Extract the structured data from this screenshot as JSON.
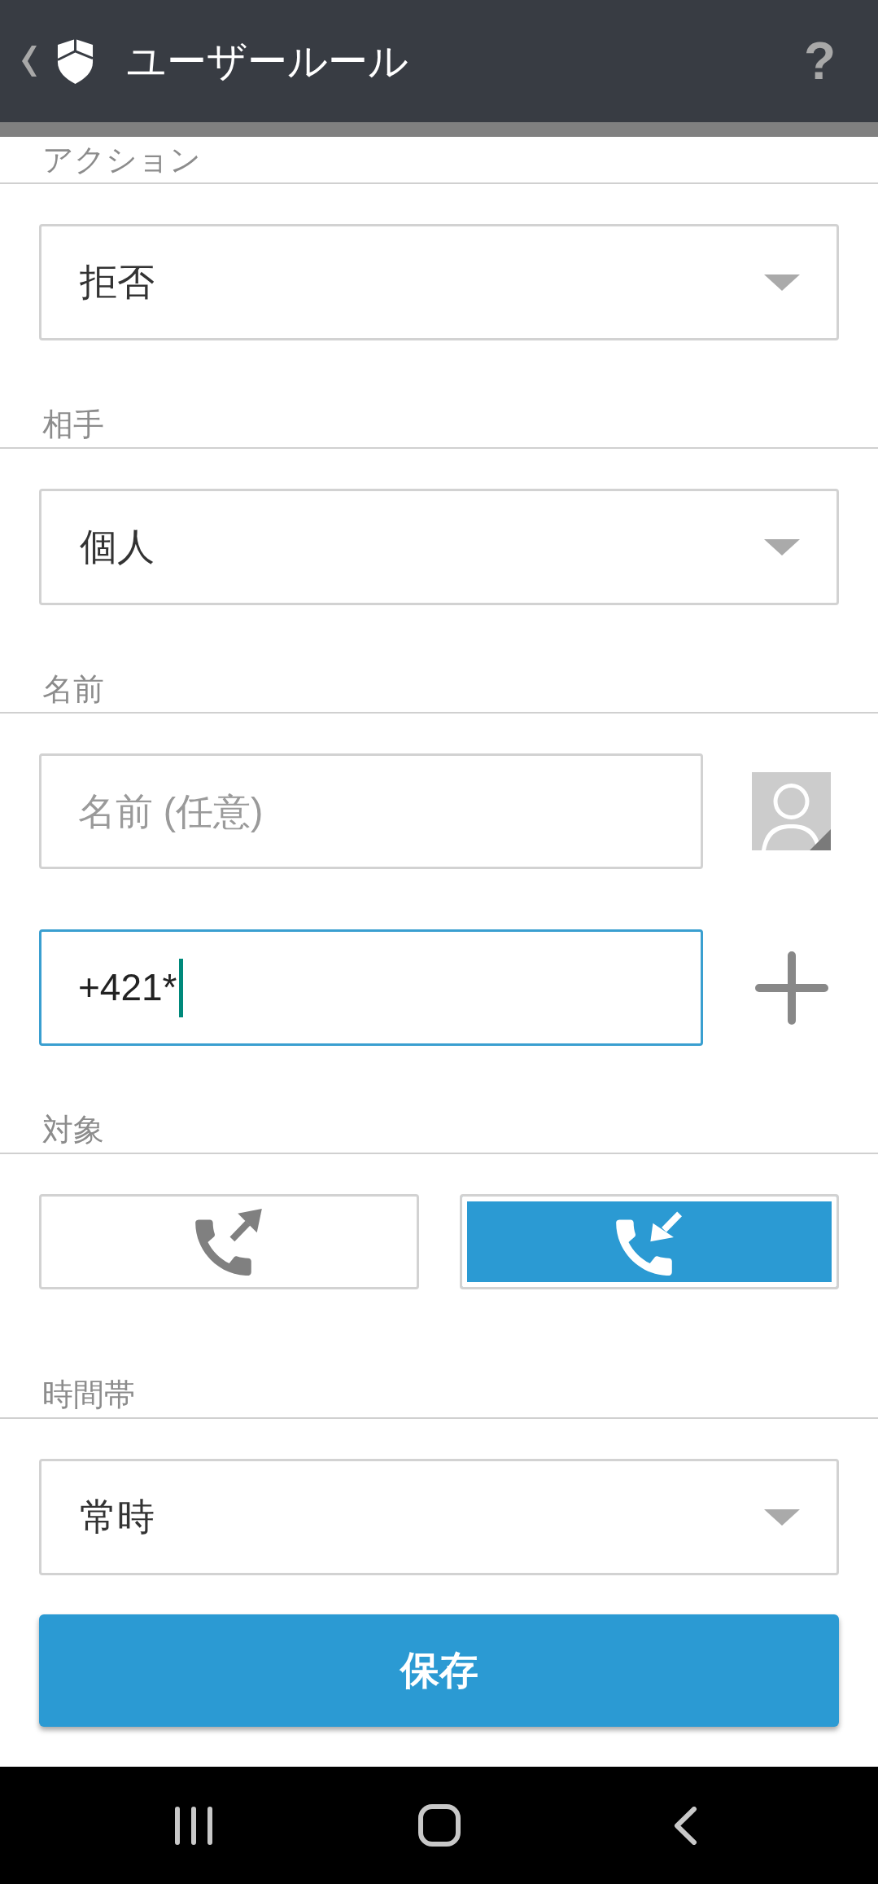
{
  "app_bar": {
    "title": "ユーザールール",
    "help": "?"
  },
  "sections": [
    {
      "kind": "dropdown",
      "label": "アクション",
      "value": "拒否"
    },
    {
      "kind": "dropdown",
      "label": "相手",
      "value": "個人"
    },
    {
      "kind": "contact",
      "label": "名前",
      "name_field": {
        "placeholder": "名前 (任意)"
      },
      "number_field": {
        "value": "+421*",
        "focused": true
      }
    },
    {
      "kind": "direction",
      "label": "対象",
      "options": [
        {
          "kind": "outgoing",
          "selected": false
        },
        {
          "kind": "incoming",
          "selected": true
        }
      ]
    },
    {
      "kind": "dropdown",
      "label": "時間帯",
      "value": "常時"
    }
  ],
  "save_button": {
    "label": "保存"
  }
}
